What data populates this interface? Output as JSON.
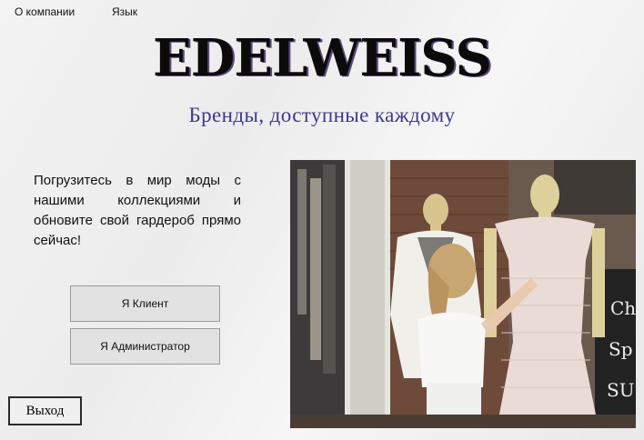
{
  "menu": {
    "about_label": "О компании",
    "language_label": "Язык"
  },
  "header": {
    "logo_text": "EDELWEISS",
    "tagline": "Бренды, доступные каждому"
  },
  "intro": {
    "text": "Погрузитесь в мир моды с нашими коллекциями и обновите свой гардероб прямо сейчас!"
  },
  "buttons": {
    "client_label": "Я Клиент",
    "admin_label": "Я Администратор",
    "exit_label": "Выход"
  },
  "colors": {
    "tagline": "#3d3a8e",
    "logo": "#0b0b0b",
    "button_bg": "#e2e2e2"
  }
}
